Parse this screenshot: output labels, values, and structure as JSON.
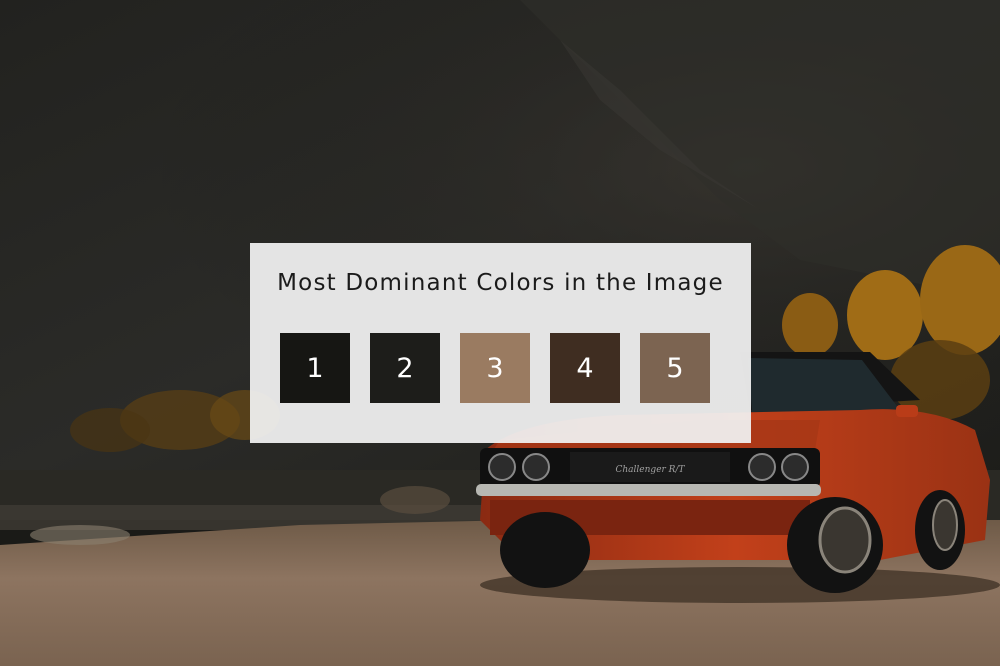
{
  "panel": {
    "title": "Most Dominant Colors in the Image"
  },
  "swatches": [
    {
      "label": "1",
      "color": "#161613"
    },
    {
      "label": "2",
      "color": "#1d1d1a"
    },
    {
      "label": "3",
      "color": "#9a7b61"
    },
    {
      "label": "4",
      "color": "#3f2d21"
    },
    {
      "label": "5",
      "color": "#7c6451"
    }
  ],
  "scene": {
    "car_badge": "Challenger R/T"
  }
}
